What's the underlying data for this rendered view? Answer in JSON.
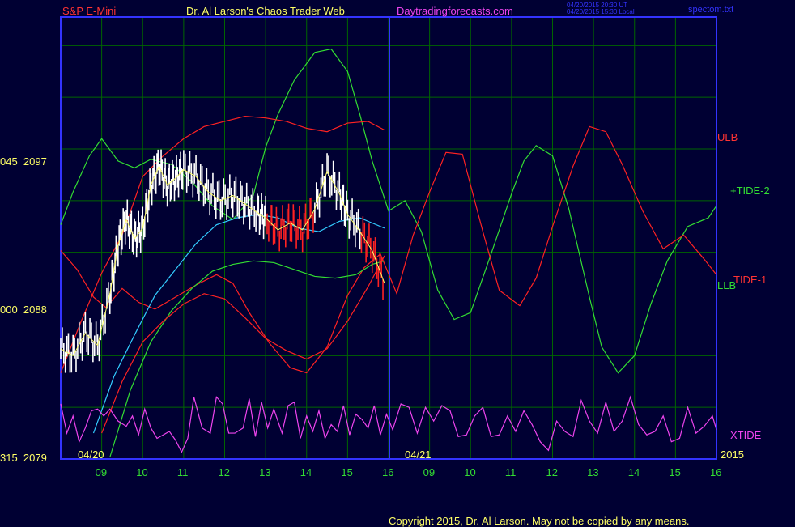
{
  "header": {
    "symbol": "S&P E-Mini",
    "author": "Dr. Al Larson's Chaos Trader Web",
    "site": "Daytradingforecasts.com",
    "time_utc": "04/20/2015 20:30 UT",
    "time_local": "04/20/2015 15:30 Local",
    "file": "spectom.txt"
  },
  "footer": {
    "copyright": "Copyright 2015, Dr. Al Larson. May not be copied by any means."
  },
  "colors": {
    "background": "#000033",
    "grid": "#006600",
    "frame": "#3333ff",
    "yellow": "#ffff66",
    "red": "#ff2222",
    "green": "#33dd33",
    "magenta": "#ee44ee",
    "cyan": "#33ccff",
    "white": "#ffffff"
  },
  "chart_data": {
    "type": "line",
    "y_ticks": [
      {
        "label": "045  2097",
        "value": 2097
      },
      {
        "label": "000  2088",
        "value": 2088
      },
      {
        "label": "315  2079",
        "value": 2079
      }
    ],
    "ylim": [
      2079,
      2097
    ],
    "date_labels": [
      "04/20",
      "04/21"
    ],
    "year_label": "2015",
    "hour_labels": [
      "09",
      "10",
      "11",
      "12",
      "13",
      "14",
      "15",
      "16",
      "09",
      "10",
      "11",
      "12",
      "13",
      "14",
      "15",
      "16"
    ],
    "series_labels": {
      "ulb": "ULB",
      "tide2": "+TIDE-2",
      "tide1": "TIDE-1",
      "llb": "LLB",
      "xtide": "XTIDE"
    },
    "series": [
      {
        "key": "tide2",
        "color": "green",
        "x": [
          0,
          0.3,
          0.7,
          1.0,
          1.4,
          1.8,
          2.2,
          2.7,
          3.2,
          3.7,
          4.2,
          4.7,
          5.0,
          5.3,
          5.7,
          6.2,
          6.6,
          7.0,
          7.3,
          7.6,
          8.0,
          8.4,
          8.8,
          9.2,
          9.6,
          10.0,
          10.5,
          11.0,
          11.3,
          11.6,
          12.0,
          12.4,
          12.9,
          13.2,
          13.6,
          14.0,
          14.4,
          14.8,
          15.3,
          15.8,
          16.0
        ],
        "y": [
          2092.6,
          2094.5,
          2096.6,
          2097.6,
          2096.3,
          2095.9,
          2096.4,
          2096.1,
          2095.1,
          2093.7,
          2092.9,
          2094.3,
          2097.1,
          2099.0,
          2101.0,
          2102.6,
          2102.8,
          2101.5,
          2099.0,
          2096.3,
          2093.4,
          2094.0,
          2092.2,
          2088.8,
          2087.1,
          2087.5,
          2090.9,
          2094.4,
          2096.3,
          2097.2,
          2096.6,
          2093.5,
          2088.4,
          2085.5,
          2084.0,
          2085.0,
          2088.0,
          2090.5,
          2092.5,
          2093.0,
          2093.7
        ]
      },
      {
        "key": "tide1",
        "color": "red",
        "x": [
          0,
          0.4,
          0.8,
          1.1,
          1.5,
          1.9,
          2.3,
          2.8,
          3.3,
          3.8,
          4.2,
          4.6,
          5.1,
          5.6,
          6.0,
          6.5,
          7.0,
          7.4,
          7.8,
          8.2,
          8.6,
          9.0,
          9.4,
          9.8,
          10.3,
          10.7,
          11.2,
          11.6,
          12.0,
          12.5,
          12.9,
          13.3,
          13.7,
          14.2,
          14.7,
          15.2,
          15.7,
          16.0
        ],
        "y": [
          2091.1,
          2090.0,
          2088.4,
          2087.8,
          2088.9,
          2088.1,
          2087.7,
          2088.4,
          2089.1,
          2089.7,
          2089.2,
          2087.5,
          2085.7,
          2084.3,
          2084.0,
          2085.5,
          2088.5,
          2090.1,
          2090.9,
          2088.6,
          2092.0,
          2094.5,
          2096.8,
          2096.7,
          2092.2,
          2088.8,
          2087.9,
          2089.5,
          2092.5,
          2096.0,
          2098.3,
          2098.0,
          2096.1,
          2093.4,
          2091.2,
          2092.0,
          2090.6,
          2089.7
        ]
      },
      {
        "key": "ulb",
        "color": "red",
        "x": [
          0,
          0.5,
          1.0,
          1.5,
          2.0,
          2.5,
          3.0,
          3.5,
          4.0,
          4.5,
          5.0,
          5.5,
          6.0,
          6.5,
          7.0,
          7.5,
          7.9
        ],
        "y": [
          2084.0,
          2087.0,
          2089.8,
          2092.0,
          2095.4,
          2096.6,
          2097.6,
          2098.3,
          2098.6,
          2098.9,
          2098.8,
          2098.6,
          2098.2,
          2098.0,
          2098.5,
          2098.6,
          2098.1
        ]
      },
      {
        "key": "llb",
        "color": "green",
        "x": [
          1.2,
          1.7,
          2.2,
          2.7,
          3.2,
          3.7,
          4.2,
          4.7,
          5.2,
          5.7,
          6.2,
          6.7,
          7.2,
          7.6,
          7.9
        ],
        "y": [
          2079.1,
          2083.0,
          2085.8,
          2087.6,
          2088.9,
          2089.9,
          2090.3,
          2090.5,
          2090.4,
          2090.0,
          2089.6,
          2089.5,
          2089.7,
          2090.3,
          2090.5
        ]
      },
      {
        "key": "ll2",
        "color": "red",
        "x": [
          1.0,
          1.5,
          2.0,
          2.5,
          3.0,
          3.5,
          4.0,
          4.5,
          5.0,
          5.5,
          6.0,
          6.5,
          7.0,
          7.5,
          7.9
        ],
        "y": [
          2080.5,
          2083.5,
          2085.8,
          2087.0,
          2088.0,
          2088.6,
          2088.3,
          2087.2,
          2086.0,
          2085.3,
          2084.8,
          2085.4,
          2087.0,
          2089.0,
          2090.8
        ]
      },
      {
        "key": "cyan",
        "color": "cyan",
        "x": [
          0.8,
          1.3,
          1.8,
          2.3,
          2.8,
          3.3,
          3.8,
          4.3,
          4.8,
          5.3,
          5.8,
          6.3,
          6.8,
          7.3,
          7.9
        ],
        "y": [
          2080.5,
          2083.8,
          2086.2,
          2088.5,
          2090.0,
          2091.5,
          2092.6,
          2093.0,
          2093.2,
          2093.0,
          2092.4,
          2092.2,
          2092.8,
          2093.0,
          2092.4
        ]
      },
      {
        "key": "price",
        "color": "white",
        "x": [
          0,
          0.3,
          0.6,
          0.9,
          1.2,
          1.4,
          1.6,
          1.8,
          2.0,
          2.2,
          2.4,
          2.6,
          2.8,
          3.0,
          3.3,
          3.6,
          3.9,
          4.2,
          4.5,
          4.8,
          5.0,
          5.3,
          5.6,
          5.9,
          6.2,
          6.5,
          6.8,
          7.0,
          7.3,
          7.6,
          7.9
        ],
        "y": [
          2085.4,
          2085.0,
          2086.3,
          2085.6,
          2088.6,
          2091.4,
          2092.9,
          2091.8,
          2092.4,
          2094.9,
          2096.0,
          2094.9,
          2095.3,
          2095.8,
          2095.4,
          2094.5,
          2094.0,
          2094.3,
          2093.8,
          2093.3,
          2093.0,
          2092.3,
          2092.7,
          2092.3,
          2093.5,
          2095.7,
          2094.4,
          2093.2,
          2092.2,
          2091.1,
          2089.2
        ]
      },
      {
        "key": "xtide",
        "color": "magenta",
        "x": [
          0,
          0.15,
          0.3,
          0.45,
          0.6,
          0.75,
          0.9,
          1.05,
          1.2,
          1.4,
          1.6,
          1.75,
          1.9,
          2.05,
          2.2,
          2.35,
          2.5,
          2.65,
          2.8,
          2.95,
          3.1,
          3.25,
          3.45,
          3.65,
          3.8,
          3.95,
          4.1,
          4.25,
          4.45,
          4.6,
          4.75,
          4.9,
          5.05,
          5.2,
          5.4,
          5.55,
          5.7,
          5.85,
          6.0,
          6.15,
          6.3,
          6.45,
          6.6,
          6.75,
          6.9,
          7.05,
          7.2,
          7.35,
          7.5,
          7.65,
          7.8,
          7.95,
          8.1,
          8.3,
          8.5,
          8.7,
          8.9,
          9.1,
          9.3,
          9.5,
          9.7,
          9.9,
          10.1,
          10.3,
          10.5,
          10.7,
          10.9,
          11.1,
          11.3,
          11.5,
          11.7,
          11.9,
          12.1,
          12.3,
          12.5,
          12.7,
          12.9,
          13.1,
          13.3,
          13.5,
          13.7,
          13.9,
          14.1,
          14.3,
          14.5,
          14.7,
          14.9,
          15.1,
          15.3,
          15.5,
          15.7,
          15.9,
          16.0
        ],
        "y": [
          2082.2,
          2080.5,
          2081.5,
          2080.0,
          2080.8,
          2081.8,
          2081.9,
          2081.5,
          2081.9,
          2081.2,
          2080.9,
          2081.5,
          2080.4,
          2081.9,
          2080.8,
          2080.2,
          2080.4,
          2080.6,
          2080.1,
          2079.4,
          2080.2,
          2082.6,
          2080.8,
          2080.5,
          2082.6,
          2082.2,
          2080.5,
          2080.5,
          2080.8,
          2082.5,
          2080.3,
          2082.3,
          2080.8,
          2081.9,
          2080.5,
          2082.1,
          2082.3,
          2080.2,
          2081.5,
          2080.6,
          2081.8,
          2080.2,
          2081.0,
          2080.6,
          2082.1,
          2080.4,
          2081.6,
          2081.3,
          2080.8,
          2082.1,
          2080.4,
          2081.6,
          2080.7,
          2082.2,
          2082.0,
          2080.5,
          2082.0,
          2081.2,
          2082.1,
          2081.8,
          2080.3,
          2080.4,
          2081.5,
          2082.0,
          2080.3,
          2080.4,
          2081.5,
          2080.6,
          2081.8,
          2081.0,
          2080.0,
          2079.5,
          2081.2,
          2080.6,
          2080.3,
          2082.4,
          2081.2,
          2080.5,
          2082.3,
          2080.6,
          2081.2,
          2082.6,
          2081.0,
          2080.4,
          2080.6,
          2081.5,
          2080.0,
          2080.2,
          2082.0,
          2080.5,
          2080.9,
          2081.5,
          2080.7
        ]
      }
    ],
    "grid": true
  }
}
